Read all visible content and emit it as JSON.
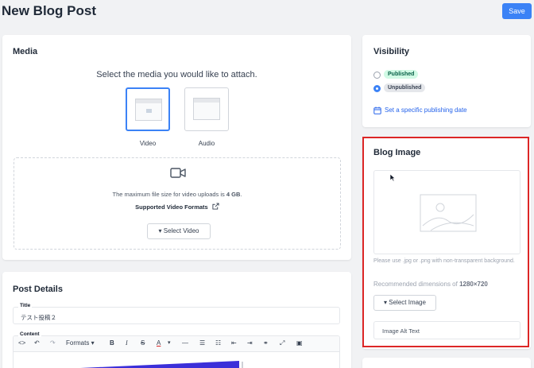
{
  "header": {
    "title": "New Blog Post",
    "save_label": "Save"
  },
  "media": {
    "title": "Media",
    "prompt": "Select the media you would like to attach.",
    "options": [
      {
        "label": "Video",
        "selected": true
      },
      {
        "label": "Audio",
        "selected": false
      }
    ],
    "max_size_prefix": "The maximum file size for video uploads is ",
    "max_size_value": "4 GB",
    "max_size_suffix": ".",
    "formats_link": "Supported Video Formats",
    "select_button": "Select Video"
  },
  "post_details": {
    "title": "Post Details",
    "title_label": "Title",
    "title_value": "テスト投稿２",
    "content_label": "Content",
    "toolbar": {
      "formats": "Formats",
      "bold": "B",
      "italic": "I",
      "strike": "S",
      "color": "A"
    }
  },
  "visibility": {
    "title": "Visibility",
    "options": [
      {
        "label": "Published",
        "selected": false
      },
      {
        "label": "Unpublished",
        "selected": true
      }
    ],
    "schedule_link": "Set a specific publishing date"
  },
  "blog_image": {
    "title": "Blog Image",
    "note": "Please use .jpg or .png with non-transparent background.",
    "dims_prefix": "Recommended dimensions of ",
    "dims_value": "1280×720",
    "select_button": "Select Image",
    "alt_placeholder": "Image Alt Text"
  },
  "colors": {
    "accent": "#3b82f6",
    "highlight": "#dc2626"
  }
}
